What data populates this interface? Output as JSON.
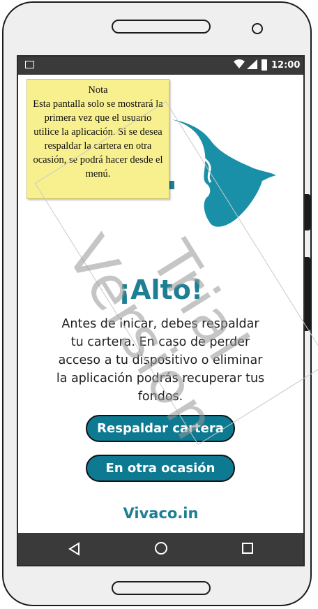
{
  "status_bar": {
    "time": "12:00"
  },
  "note": {
    "title": "Nota",
    "text": "Esta pantalla solo se mostrará la primera vez que el usuario utilice la aplicación. Si se desea respaldar la cartera en otra ocasión, se podrá hacer desde el menú."
  },
  "main": {
    "title": "¡Alto!",
    "message": "Antes de inicar, debes respaldar tu cartera. En caso de perder acceso a tu dispositivo o eliminar la aplicación podrás recuperar tus fondos.",
    "backup_button": "Respaldar cartera",
    "later_button": "En otra ocasión",
    "brand": "Vivaco.in"
  },
  "watermark": "Trial Version",
  "colors": {
    "accent": "#1d7f93",
    "button": "#0e7a92",
    "note_bg": "#f8f08f",
    "bars": "#3a3a3a"
  },
  "icons": [
    "image-icon",
    "wifi-icon",
    "signal-icon",
    "battery-icon",
    "back-icon",
    "home-icon",
    "recents-icon",
    "dove-logo"
  ]
}
